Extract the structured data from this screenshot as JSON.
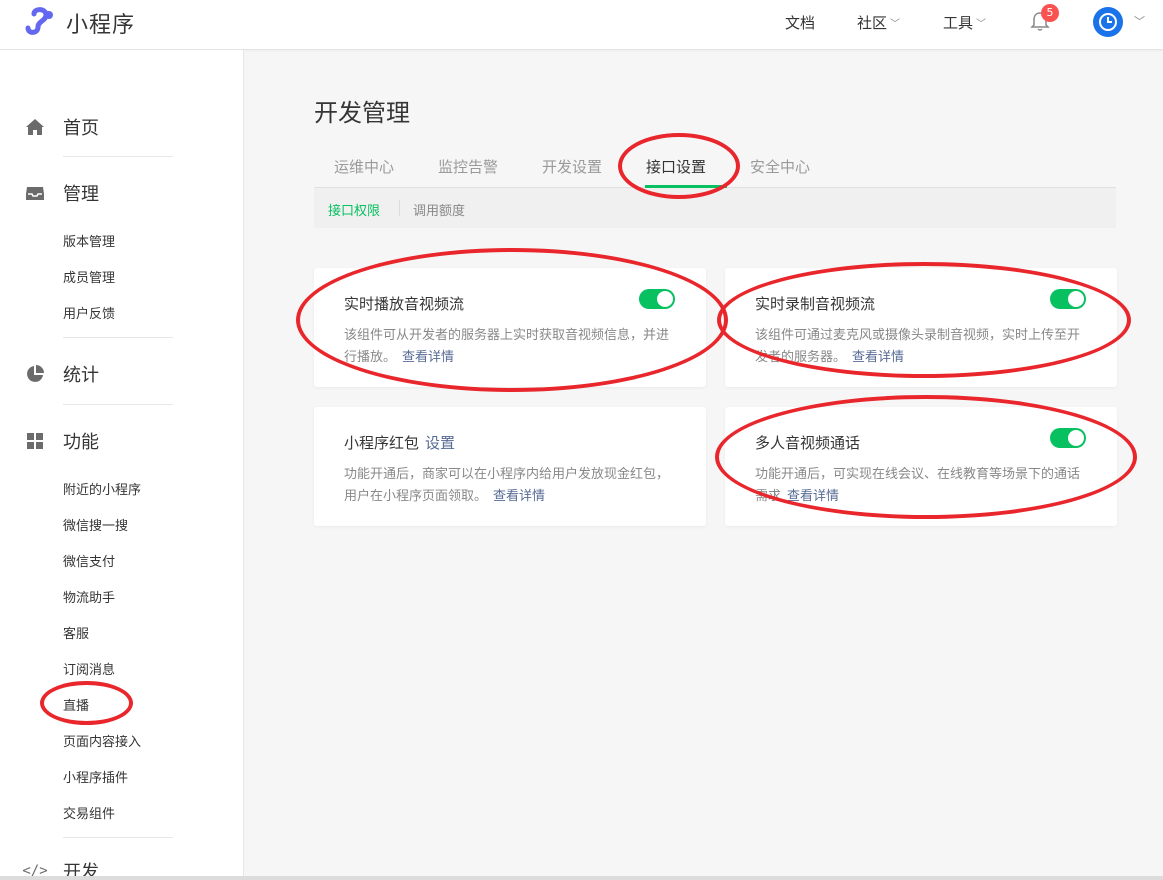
{
  "app": {
    "title": "小程序"
  },
  "topnav": {
    "docs": "文档",
    "community": "社区",
    "tools": "工具",
    "notification_count": "5"
  },
  "sidebar": {
    "home": "首页",
    "manage": "管理",
    "manage_items": [
      "版本管理",
      "成员管理",
      "用户反馈"
    ],
    "stats": "统计",
    "features": "功能",
    "feature_items": [
      "附近的小程序",
      "微信搜一搜",
      "微信支付",
      "物流助手",
      "客服",
      "订阅消息",
      "直播",
      "页面内容接入",
      "小程序插件",
      "交易组件"
    ],
    "dev": "开发"
  },
  "page": {
    "title": "开发管理",
    "tabs": [
      "运维中心",
      "监控告警",
      "开发设置",
      "接口设置",
      "安全中心"
    ],
    "active_tab": "接口设置",
    "subtabs": [
      "接口权限",
      "调用额度"
    ]
  },
  "cards": [
    {
      "title": "实时播放音视频流",
      "desc": "该组件可从开发者的服务器上实时获取音视频信息，并进行播放。",
      "link": "查看详情",
      "enabled": true
    },
    {
      "title": "实时录制音视频流",
      "desc": "该组件可通过麦克风或摄像头录制音视频，实时上传至开发者的服务器。",
      "link": "查看详情",
      "enabled": true
    },
    {
      "title": "小程序红包",
      "setting": "设置",
      "desc": "功能开通后，商家可以在小程序内给用户发放现金红包，用户在小程序页面领取。",
      "link": "查看详情"
    },
    {
      "title": "多人音视频通话",
      "desc": "功能开通后，可实现在线会议、在线教育等场景下的通话需求",
      "link": "查看详情",
      "enabled": true
    }
  ],
  "colors": {
    "accent": "#07c160",
    "link": "#576b95",
    "annotation": "#e8262b",
    "badge": "#fa5151"
  }
}
